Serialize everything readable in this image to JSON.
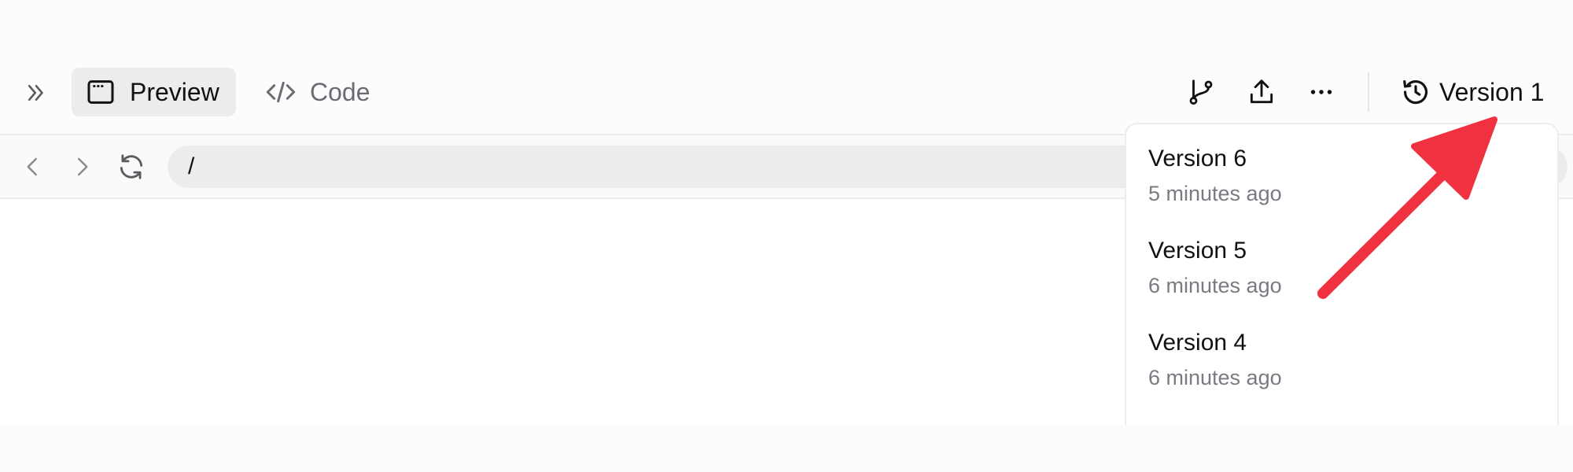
{
  "toolbar": {
    "tabs": [
      {
        "label": "Preview",
        "icon": "browser-window-icon",
        "active": true
      },
      {
        "label": "Code",
        "icon": "code-icon",
        "active": false
      }
    ],
    "tools": [
      {
        "icon": "branch-icon"
      },
      {
        "icon": "share-icon"
      },
      {
        "icon": "more-icon"
      }
    ],
    "version_label": "Version 1",
    "version_icon": "history-icon"
  },
  "navbar": {
    "url": "/"
  },
  "versions_dropdown": {
    "items": [
      {
        "name": "Version 6",
        "time": "5 minutes ago"
      },
      {
        "name": "Version 5",
        "time": "6 minutes ago"
      },
      {
        "name": "Version 4",
        "time": "6 minutes ago"
      }
    ]
  },
  "colors": {
    "annotation_arrow": "#f0313f",
    "active_tab_bg": "#ececef",
    "muted_text": "#7a7a82"
  }
}
